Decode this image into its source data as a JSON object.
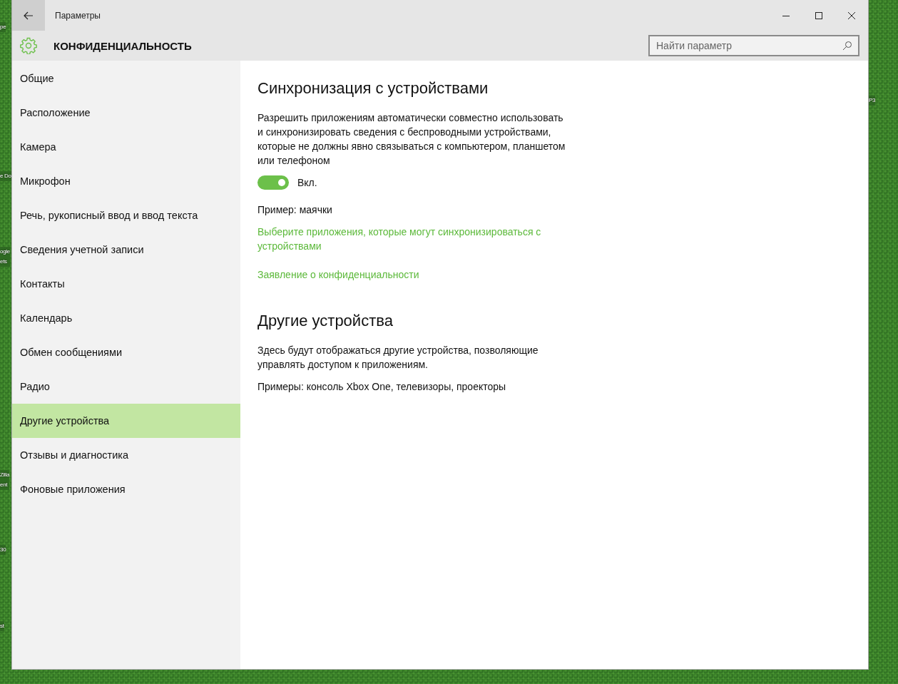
{
  "desktop": {
    "left_icons": [
      {
        "lines": [
          "pe"
        ]
      },
      {
        "lines": [
          "e Do"
        ]
      },
      {
        "lines": [
          "ogle",
          "ets"
        ]
      },
      {
        "lines": [
          "Zilla",
          "ent"
        ]
      },
      {
        "lines": [
          "30"
        ]
      },
      {
        "lines": [
          "st"
        ]
      }
    ],
    "right_icons": [
      {
        "lines": [
          "P3"
        ]
      }
    ]
  },
  "window": {
    "title": "Параметры"
  },
  "header": {
    "title": "КОНФИДЕНЦИАЛЬНОСТЬ",
    "search": {
      "placeholder": "Найти параметр"
    }
  },
  "sidebar": {
    "items": [
      {
        "label": "Общие",
        "selected": false
      },
      {
        "label": "Расположение",
        "selected": false
      },
      {
        "label": "Камера",
        "selected": false
      },
      {
        "label": "Микрофон",
        "selected": false
      },
      {
        "label": "Речь, рукописный ввод и ввод текста",
        "selected": false
      },
      {
        "label": "Сведения учетной записи",
        "selected": false
      },
      {
        "label": "Контакты",
        "selected": false
      },
      {
        "label": "Календарь",
        "selected": false
      },
      {
        "label": "Обмен сообщениями",
        "selected": false
      },
      {
        "label": "Радио",
        "selected": false
      },
      {
        "label": "Другие устройства",
        "selected": true
      },
      {
        "label": "Отзывы и диагностика",
        "selected": false
      },
      {
        "label": "Фоновые приложения",
        "selected": false
      }
    ]
  },
  "sections": [
    {
      "heading": "Синхронизация с устройствами",
      "blocks": [
        {
          "kind": "text",
          "text": "Разрешить приложениям автоматически совместно использовать и синхронизировать сведения с беспроводными устройствами, которые не должны явно связываться с компьютером, планшетом или телефоном"
        },
        {
          "kind": "toggle",
          "on": true,
          "label": "Вкл."
        },
        {
          "kind": "text",
          "text": "Пример: маячки"
        },
        {
          "kind": "link",
          "text": "Выберите приложения, которые могут синхронизироваться с устройствами"
        },
        {
          "kind": "link",
          "text": "Заявление о конфиденциальности"
        }
      ]
    },
    {
      "heading": "Другие устройства",
      "blocks": [
        {
          "kind": "text",
          "text": "Здесь будут отображаться другие устройства, позволяющие управлять доступом к приложениям."
        },
        {
          "kind": "text",
          "text": "Примеры: консоль Xbox One, телевизоры, проекторы"
        }
      ]
    }
  ]
}
